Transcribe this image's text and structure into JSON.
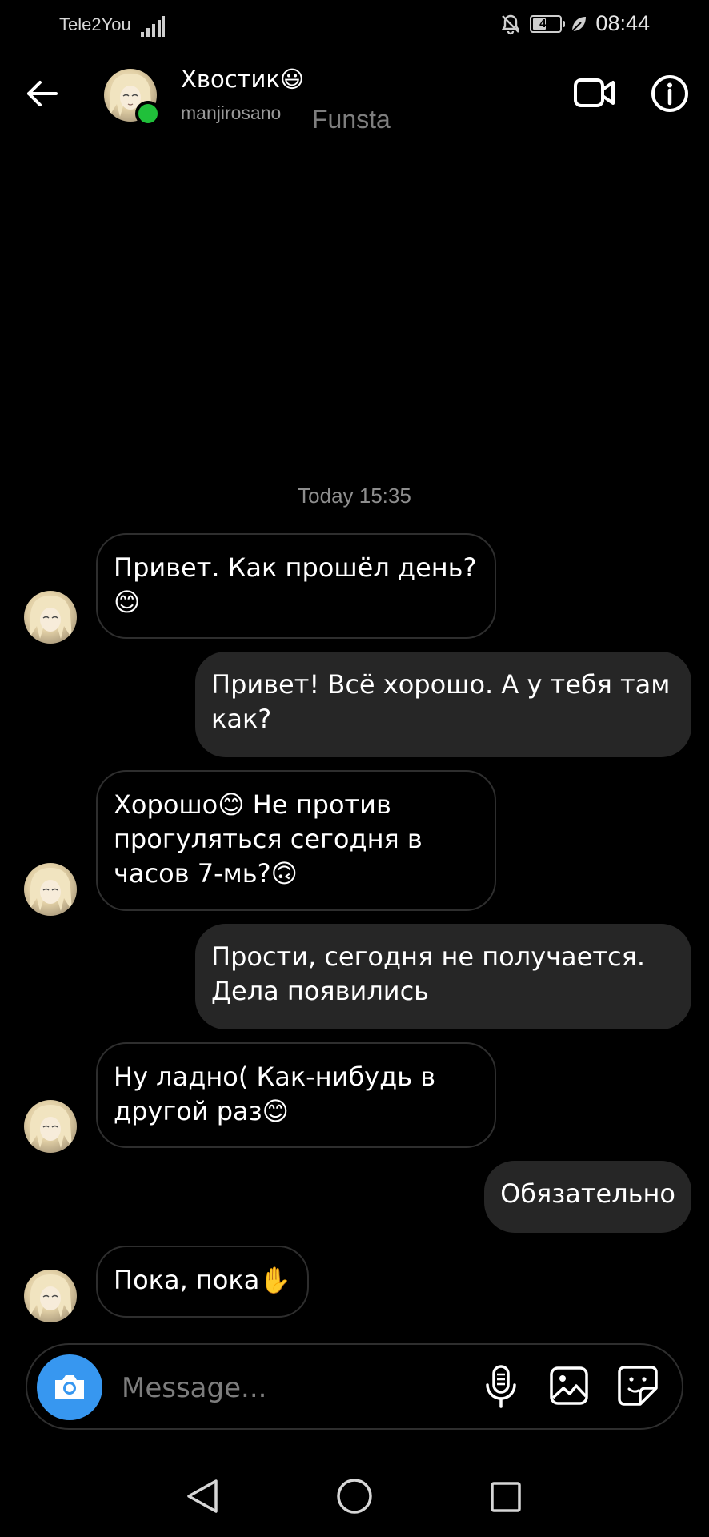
{
  "status_bar": {
    "carrier": "Tele2You",
    "battery": "49",
    "time": "08:44"
  },
  "header": {
    "contact_name": "Хвостик😃",
    "username": "manjirosano",
    "account_label": "Funsta",
    "online_color": "#20c03a"
  },
  "conversation": {
    "timestamp": "Today 15:35",
    "messages": [
      {
        "direction": "incoming",
        "text": "Привет. Как прошёл день?😊"
      },
      {
        "direction": "outgoing",
        "text": "Привет! Всё хорошо. А у тебя там как?"
      },
      {
        "direction": "incoming",
        "text": "Хорошо😊 Не против прогуляться сегодня в часов 7-мь?🙃"
      },
      {
        "direction": "outgoing",
        "text": "Прости, сегодня не получается. Дела появились"
      },
      {
        "direction": "incoming",
        "text": "Ну ладно( Как-нибудь в другой раз😊"
      },
      {
        "direction": "outgoing",
        "text": "Обязательно"
      },
      {
        "direction": "incoming",
        "text": "Пока, пока✋"
      }
    ]
  },
  "composer": {
    "placeholder": "Message...",
    "accent_color": "#3797f0"
  },
  "icons": {
    "back": "arrow-left-icon",
    "video": "video-camera-icon",
    "info": "info-icon",
    "camera": "camera-icon",
    "mic": "microphone-icon",
    "gallery": "image-icon",
    "sticker": "sticker-icon"
  }
}
